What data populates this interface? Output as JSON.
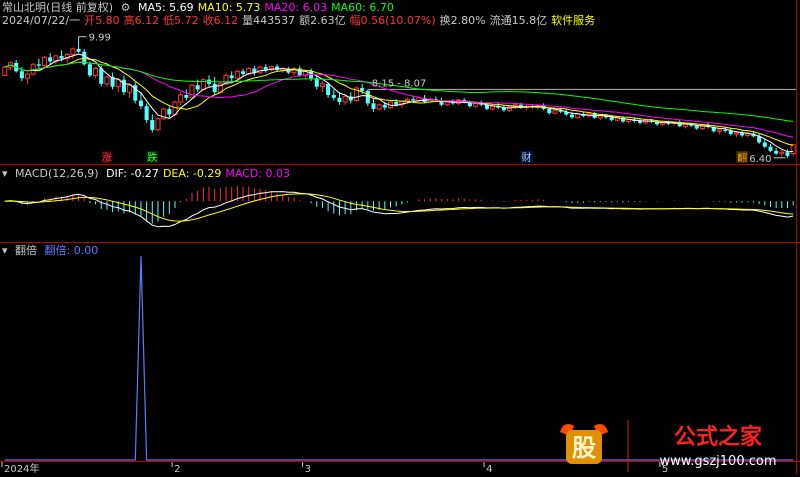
{
  "header": {
    "stock_title": "常山北明(日线 前复权)",
    "ma": [
      {
        "label": "MA5: 5.69",
        "color": "#ffffff"
      },
      {
        "label": "MA10: 5.73",
        "color": "#ffff00"
      },
      {
        "label": "MA20: 6.03",
        "color": "#ff00ff"
      },
      {
        "label": "MA60: 6.70",
        "color": "#00ff00"
      }
    ],
    "info": [
      {
        "text": "2024/07/22/一",
        "color": "#c8c8c8"
      },
      {
        "text": "开5.80",
        "color": "#ff3232"
      },
      {
        "text": "高6.12",
        "color": "#ff3232"
      },
      {
        "text": "低5.72",
        "color": "#ff3232"
      },
      {
        "text": "收6.12",
        "color": "#ff3232"
      },
      {
        "text": "量443537",
        "color": "#c8c8c8"
      },
      {
        "text": "额2.63亿",
        "color": "#c8c8c8"
      },
      {
        "text": "幅0.56(10.07%)",
        "color": "#ff3232"
      },
      {
        "text": "换2.80%",
        "color": "#c8c8c8"
      },
      {
        "text": "流通15.8亿",
        "color": "#c8c8c8"
      },
      {
        "text": "软件服务",
        "color": "#ffff00"
      }
    ],
    "macd_title": "MACD(12,26,9)",
    "macd_vals": [
      {
        "text": "DIF: -0.27",
        "color": "#ffffff"
      },
      {
        "text": "DEA: -0.29",
        "color": "#ffff00"
      },
      {
        "text": "MACD: 0.03",
        "color": "#ff00ff"
      }
    ],
    "ind_title": "翻倍",
    "ind_vals": [
      {
        "text": "翻倍: 0.00",
        "color": "#5f78ff"
      }
    ]
  },
  "annotations": {
    "price_high": "9.99",
    "price_low": "6.40",
    "range_note": "8.15 - 8.07",
    "marker_zhang": "涨",
    "marker_die": "跌",
    "marker_cai": "财",
    "marker_end": "翻"
  },
  "x_axis": {
    "ticks": [
      {
        "label": "2024年",
        "idx": 0
      },
      {
        "label": "2",
        "idx": 30
      },
      {
        "label": "3",
        "idx": 53
      },
      {
        "label": "4",
        "idx": 85
      },
      {
        "label": "5",
        "idx": 116
      }
    ]
  },
  "watermark": {
    "logo_text": "股",
    "brand": "公式之家",
    "url": "www.gszj100.com"
  },
  "colors": {
    "up": "#ff3232",
    "down": "#54ffff",
    "ma5": "#ffffff",
    "ma10": "#ffff00",
    "ma20": "#ff00ff",
    "ma60": "#00ff00",
    "dif": "#ffffff",
    "dea": "#ffff00",
    "indicator": "#5f78ff",
    "divider": "#b40000"
  },
  "chart_data": {
    "type": "candlestick",
    "price_range": [
      5.5,
      10.3
    ],
    "price_hline": 8.1,
    "macd_range": [
      -0.75,
      0.45
    ],
    "indicator_range": [
      0,
      1
    ],
    "candles": [
      [
        8.6,
        8.95,
        8.7,
        8.9
      ],
      [
        8.9,
        9.1,
        8.8,
        9.05
      ],
      [
        9.05,
        9.15,
        8.7,
        8.75
      ],
      [
        8.75,
        8.9,
        8.4,
        8.5
      ],
      [
        8.5,
        8.7,
        8.3,
        8.65
      ],
      [
        8.65,
        9.05,
        8.6,
        9.0
      ],
      [
        9.0,
        9.2,
        8.85,
        8.95
      ],
      [
        8.95,
        9.3,
        8.9,
        9.25
      ],
      [
        9.25,
        9.4,
        9.0,
        9.1
      ],
      [
        9.1,
        9.35,
        9.0,
        9.3
      ],
      [
        9.3,
        9.5,
        9.1,
        9.2
      ],
      [
        9.2,
        9.4,
        9.05,
        9.35
      ],
      [
        9.35,
        9.6,
        9.2,
        9.55
      ],
      [
        9.55,
        9.99,
        9.4,
        9.45
      ],
      [
        9.45,
        9.55,
        8.95,
        9.0
      ],
      [
        9.0,
        9.1,
        8.55,
        8.6
      ],
      [
        8.6,
        8.9,
        8.5,
        8.85
      ],
      [
        8.85,
        8.95,
        8.2,
        8.3
      ],
      [
        8.3,
        8.6,
        8.2,
        8.55
      ],
      [
        8.55,
        8.7,
        8.1,
        8.2
      ],
      [
        8.2,
        8.5,
        8.0,
        8.45
      ],
      [
        8.45,
        8.6,
        7.9,
        8.0
      ],
      [
        8.0,
        8.3,
        7.8,
        8.25
      ],
      [
        8.25,
        8.35,
        7.6,
        7.7
      ],
      [
        7.7,
        8.0,
        7.4,
        7.5
      ],
      [
        7.5,
        7.6,
        6.9,
        7.0
      ],
      [
        7.0,
        7.2,
        6.55,
        6.65
      ],
      [
        6.65,
        7.1,
        6.6,
        7.05
      ],
      [
        7.05,
        7.45,
        7.0,
        7.4
      ],
      [
        7.4,
        7.5,
        7.1,
        7.2
      ],
      [
        7.2,
        7.7,
        7.15,
        7.65
      ],
      [
        7.65,
        8.0,
        7.55,
        7.9
      ],
      [
        7.9,
        8.1,
        7.7,
        7.8
      ],
      [
        7.8,
        8.3,
        7.75,
        8.25
      ],
      [
        8.25,
        8.45,
        8.0,
        8.1
      ],
      [
        8.1,
        8.5,
        8.05,
        8.45
      ],
      [
        8.45,
        8.6,
        8.2,
        8.3
      ],
      [
        8.3,
        8.55,
        7.9,
        8.0
      ],
      [
        8.0,
        8.35,
        7.95,
        8.3
      ],
      [
        8.3,
        8.7,
        8.25,
        8.6
      ],
      [
        8.6,
        8.75,
        8.4,
        8.5
      ],
      [
        8.5,
        8.8,
        8.45,
        8.75
      ],
      [
        8.75,
        8.85,
        8.55,
        8.65
      ],
      [
        8.65,
        8.9,
        8.6,
        8.85
      ],
      [
        8.85,
        8.95,
        8.6,
        8.7
      ],
      [
        8.7,
        8.95,
        8.65,
        8.9
      ],
      [
        8.9,
        9.0,
        8.7,
        8.8
      ],
      [
        8.8,
        8.95,
        8.75,
        8.92
      ],
      [
        8.92,
        9.0,
        8.75,
        8.8
      ],
      [
        8.8,
        8.9,
        8.7,
        8.85
      ],
      [
        8.85,
        8.9,
        8.65,
        8.7
      ],
      [
        8.7,
        8.9,
        8.6,
        8.85
      ],
      [
        8.85,
        8.95,
        8.55,
        8.6
      ],
      [
        8.6,
        8.8,
        8.45,
        8.75
      ],
      [
        8.75,
        8.85,
        8.4,
        8.5
      ],
      [
        8.5,
        8.6,
        8.1,
        8.2
      ],
      [
        8.2,
        8.4,
        8.0,
        8.3
      ],
      [
        8.3,
        8.35,
        7.8,
        7.9
      ],
      [
        7.9,
        8.1,
        7.7,
        7.8
      ],
      [
        7.8,
        8.0,
        7.55,
        7.65
      ],
      [
        7.65,
        7.9,
        7.55,
        7.85
      ],
      [
        7.85,
        8.0,
        7.6,
        7.7
      ],
      [
        7.7,
        8.2,
        7.65,
        8.15
      ],
      [
        8.15,
        8.3,
        7.95,
        8.05
      ],
      [
        8.05,
        8.1,
        7.5,
        7.6
      ],
      [
        7.6,
        7.75,
        7.3,
        7.4
      ],
      [
        7.4,
        7.6,
        7.35,
        7.55
      ],
      [
        7.55,
        7.65,
        7.35,
        7.45
      ],
      [
        7.45,
        7.7,
        7.4,
        7.65
      ],
      [
        7.65,
        7.75,
        7.5,
        7.55
      ],
      [
        7.55,
        7.7,
        7.45,
        7.68
      ],
      [
        7.68,
        7.8,
        7.6,
        7.75
      ],
      [
        7.75,
        7.85,
        7.62,
        7.7
      ],
      [
        7.7,
        7.85,
        7.65,
        7.8
      ],
      [
        7.8,
        7.9,
        7.6,
        7.65
      ],
      [
        7.65,
        7.8,
        7.6,
        7.75
      ],
      [
        7.75,
        7.85,
        7.65,
        7.7
      ],
      [
        7.7,
        7.8,
        7.5,
        7.55
      ],
      [
        7.55,
        7.7,
        7.5,
        7.65
      ],
      [
        7.65,
        7.75,
        7.55,
        7.6
      ],
      [
        7.6,
        7.75,
        7.55,
        7.72
      ],
      [
        7.72,
        7.8,
        7.6,
        7.65
      ],
      [
        7.65,
        7.7,
        7.45,
        7.5
      ],
      [
        7.5,
        7.65,
        7.45,
        7.6
      ],
      [
        7.6,
        7.7,
        7.5,
        7.55
      ],
      [
        7.55,
        7.6,
        7.35,
        7.4
      ],
      [
        7.4,
        7.55,
        7.35,
        7.5
      ],
      [
        7.5,
        7.6,
        7.4,
        7.45
      ],
      [
        7.45,
        7.55,
        7.3,
        7.35
      ],
      [
        7.35,
        7.5,
        7.3,
        7.48
      ],
      [
        7.48,
        7.6,
        7.4,
        7.55
      ],
      [
        7.55,
        7.62,
        7.4,
        7.45
      ],
      [
        7.45,
        7.55,
        7.35,
        7.5
      ],
      [
        7.5,
        7.58,
        7.42,
        7.46
      ],
      [
        7.46,
        7.55,
        7.38,
        7.52
      ],
      [
        7.52,
        7.6,
        7.35,
        7.4
      ],
      [
        7.4,
        7.45,
        7.2,
        7.25
      ],
      [
        7.25,
        7.4,
        7.2,
        7.35
      ],
      [
        7.35,
        7.42,
        7.25,
        7.3
      ],
      [
        7.3,
        7.38,
        7.15,
        7.2
      ],
      [
        7.2,
        7.3,
        7.05,
        7.1
      ],
      [
        7.1,
        7.25,
        7.05,
        7.22
      ],
      [
        7.22,
        7.3,
        7.1,
        7.15
      ],
      [
        7.15,
        7.28,
        7.1,
        7.25
      ],
      [
        7.25,
        7.3,
        7.05,
        7.08
      ],
      [
        7.08,
        7.2,
        7.0,
        7.15
      ],
      [
        7.15,
        7.22,
        7.05,
        7.1
      ],
      [
        7.1,
        7.15,
        6.95,
        7.0
      ],
      [
        7.0,
        7.12,
        6.95,
        7.08
      ],
      [
        7.08,
        7.15,
        6.9,
        6.95
      ],
      [
        6.95,
        7.05,
        6.88,
        7.02
      ],
      [
        7.02,
        7.1,
        6.92,
        6.97
      ],
      [
        6.97,
        7.05,
        6.85,
        6.9
      ],
      [
        6.9,
        7.0,
        6.85,
        6.98
      ],
      [
        6.98,
        7.05,
        6.9,
        6.95
      ],
      [
        6.95,
        7.0,
        6.8,
        6.85
      ],
      [
        6.85,
        6.95,
        6.78,
        6.9
      ],
      [
        6.9,
        6.98,
        6.82,
        6.88
      ],
      [
        6.88,
        6.95,
        6.8,
        6.92
      ],
      [
        6.92,
        7.0,
        6.75,
        6.78
      ],
      [
        6.78,
        6.9,
        6.7,
        6.85
      ],
      [
        6.85,
        6.92,
        6.75,
        6.8
      ],
      [
        6.8,
        6.88,
        6.65,
        6.7
      ],
      [
        6.7,
        6.85,
        6.65,
        6.82
      ],
      [
        6.82,
        6.9,
        6.7,
        6.75
      ],
      [
        6.75,
        6.82,
        6.55,
        6.6
      ],
      [
        6.6,
        6.7,
        6.5,
        6.65
      ],
      [
        6.65,
        6.75,
        6.55,
        6.62
      ],
      [
        6.62,
        6.7,
        6.45,
        6.5
      ],
      [
        6.5,
        6.6,
        6.4,
        6.55
      ],
      [
        6.55,
        6.62,
        6.4,
        6.45
      ],
      [
        6.45,
        6.58,
        6.4,
        6.52
      ],
      [
        6.52,
        6.6,
        6.38,
        6.42
      ],
      [
        6.42,
        6.5,
        6.15,
        6.2
      ],
      [
        6.2,
        6.3,
        6.0,
        6.05
      ],
      [
        6.05,
        6.15,
        5.85,
        5.9
      ],
      [
        5.9,
        6.0,
        5.75,
        5.8
      ],
      [
        5.8,
        5.95,
        5.7,
        5.85
      ],
      [
        5.85,
        5.95,
        5.65,
        5.72
      ],
      [
        5.8,
        6.12,
        5.72,
        6.12
      ]
    ],
    "indicator_spike": {
      "idx": 24,
      "value": 1
    }
  }
}
